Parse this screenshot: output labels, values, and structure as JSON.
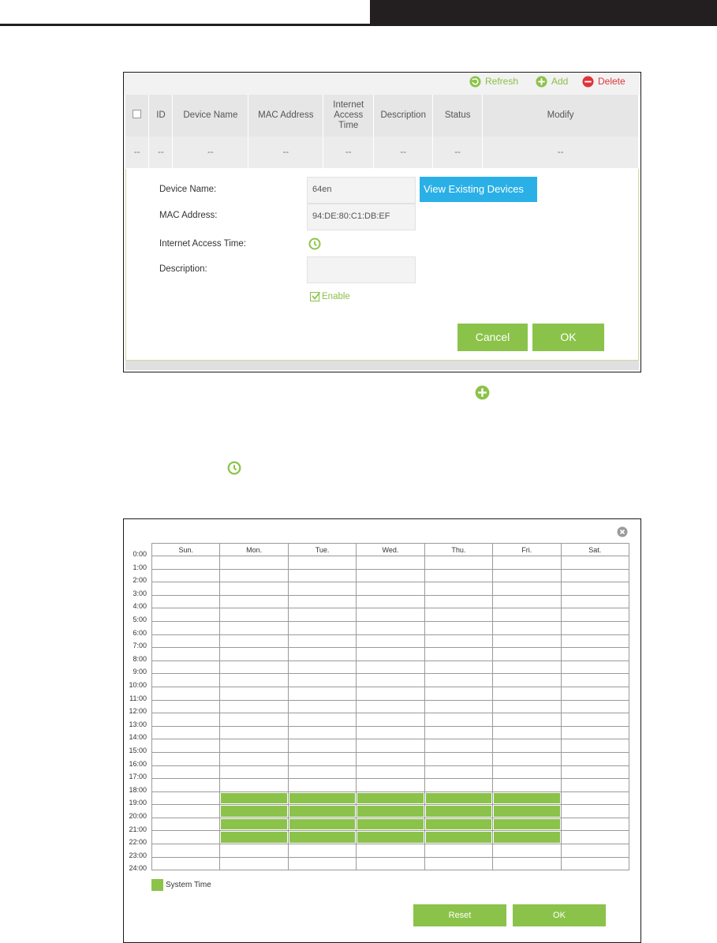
{
  "toolbar": {
    "refresh_label": "Refresh",
    "add_label": "Add",
    "delete_label": "Delete"
  },
  "device_table": {
    "headers": [
      "ID",
      "Device Name",
      "MAC Address",
      "Internet Access Time",
      "Description",
      "Status",
      "Modify"
    ],
    "row": [
      "--",
      "--",
      "--",
      "--",
      "--",
      "--",
      "--",
      "--"
    ]
  },
  "form": {
    "device_name_label": "Device Name:",
    "device_name_value": "64en",
    "view_devices_label": "View Existing Devices",
    "mac_label": "MAC Address:",
    "mac_value": "94:DE:80:C1:DB:EF",
    "access_time_label": "Internet Access Time:",
    "description_label": "Description:",
    "description_value": "",
    "enable_label": "Enable",
    "enable_checked": true,
    "cancel_label": "Cancel",
    "ok_label": "OK"
  },
  "schedule": {
    "days": [
      "Sun.",
      "Mon.",
      "Tue.",
      "Wed.",
      "Thu.",
      "Fri.",
      "Sat."
    ],
    "hours": [
      "0:00",
      "1:00",
      "2:00",
      "3:00",
      "4:00",
      "5:00",
      "6:00",
      "7:00",
      "8:00",
      "9:00",
      "10:00",
      "11:00",
      "12:00",
      "13:00",
      "14:00",
      "15:00",
      "16:00",
      "17:00",
      "18:00",
      "19:00",
      "20:00",
      "21:00",
      "22:00",
      "23:00",
      "24:00"
    ],
    "selected_days": [
      "Mon.",
      "Tue.",
      "Wed.",
      "Thu.",
      "Fri."
    ],
    "selected_hours": [
      "18:00",
      "19:00",
      "20:00",
      "21:00"
    ],
    "legend_label": "System Time",
    "reset_label": "Reset",
    "ok_label": "OK"
  },
  "colors": {
    "accent_green": "#8bc34a",
    "blue_button": "#2ab0e6",
    "delete_red": "#e0343a"
  },
  "icons": [
    "refresh-icon",
    "add-icon",
    "delete-icon",
    "clock-icon",
    "close-icon",
    "checkbox-icon"
  ]
}
